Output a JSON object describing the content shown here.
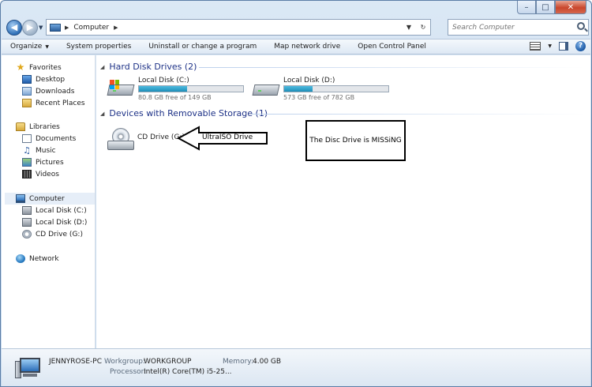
{
  "window": {
    "caption_buttons": [
      "–",
      "□",
      "✕"
    ]
  },
  "address": {
    "segments": [
      "Computer"
    ],
    "search_placeholder": "Search Computer"
  },
  "toolbar": {
    "organize": "Organize",
    "system_properties": "System properties",
    "uninstall": "Uninstall or change a program",
    "map_drive": "Map network drive",
    "control_panel": "Open Control Panel"
  },
  "navpane": {
    "favorites": "Favorites",
    "desktop": "Desktop",
    "downloads": "Downloads",
    "recent": "Recent Places",
    "libraries": "Libraries",
    "documents": "Documents",
    "music": "Music",
    "pictures": "Pictures",
    "videos": "Videos",
    "computer": "Computer",
    "disk_c": "Local Disk (C:)",
    "disk_d": "Local Disk (D:)",
    "cd_g": "CD Drive (G:)",
    "network": "Network"
  },
  "content": {
    "hdd_group": "Hard Disk Drives (2)",
    "removable_group": "Devices with Removable Storage (1)",
    "drives": [
      {
        "name": "Local Disk (C:)",
        "free": "80.8 GB free of 149 GB",
        "used_fraction": 0.46
      },
      {
        "name": "Local Disk (D:)",
        "free": "573 GB free of 782 GB",
        "used_fraction": 0.27
      }
    ],
    "cd_drive": "CD Drive (G:)"
  },
  "annotations": {
    "arrow_label": "UltraISO Drive",
    "box_text": "The Disc Drive is MISSiNG"
  },
  "details": {
    "pc_name": "JENNYROSE-PC",
    "workgroup_label": "Workgroup:",
    "workgroup": "WORKGROUP",
    "memory_label": "Memory:",
    "memory": "4.00 GB",
    "processor_label": "Processor:",
    "processor": "Intel(R) Core(TM) i5-25..."
  },
  "colors": {
    "window_frame": "#c3d8ee",
    "group_header": "#1e3287",
    "usage_bar": "#26a0da",
    "close_button": "#c9462c"
  }
}
